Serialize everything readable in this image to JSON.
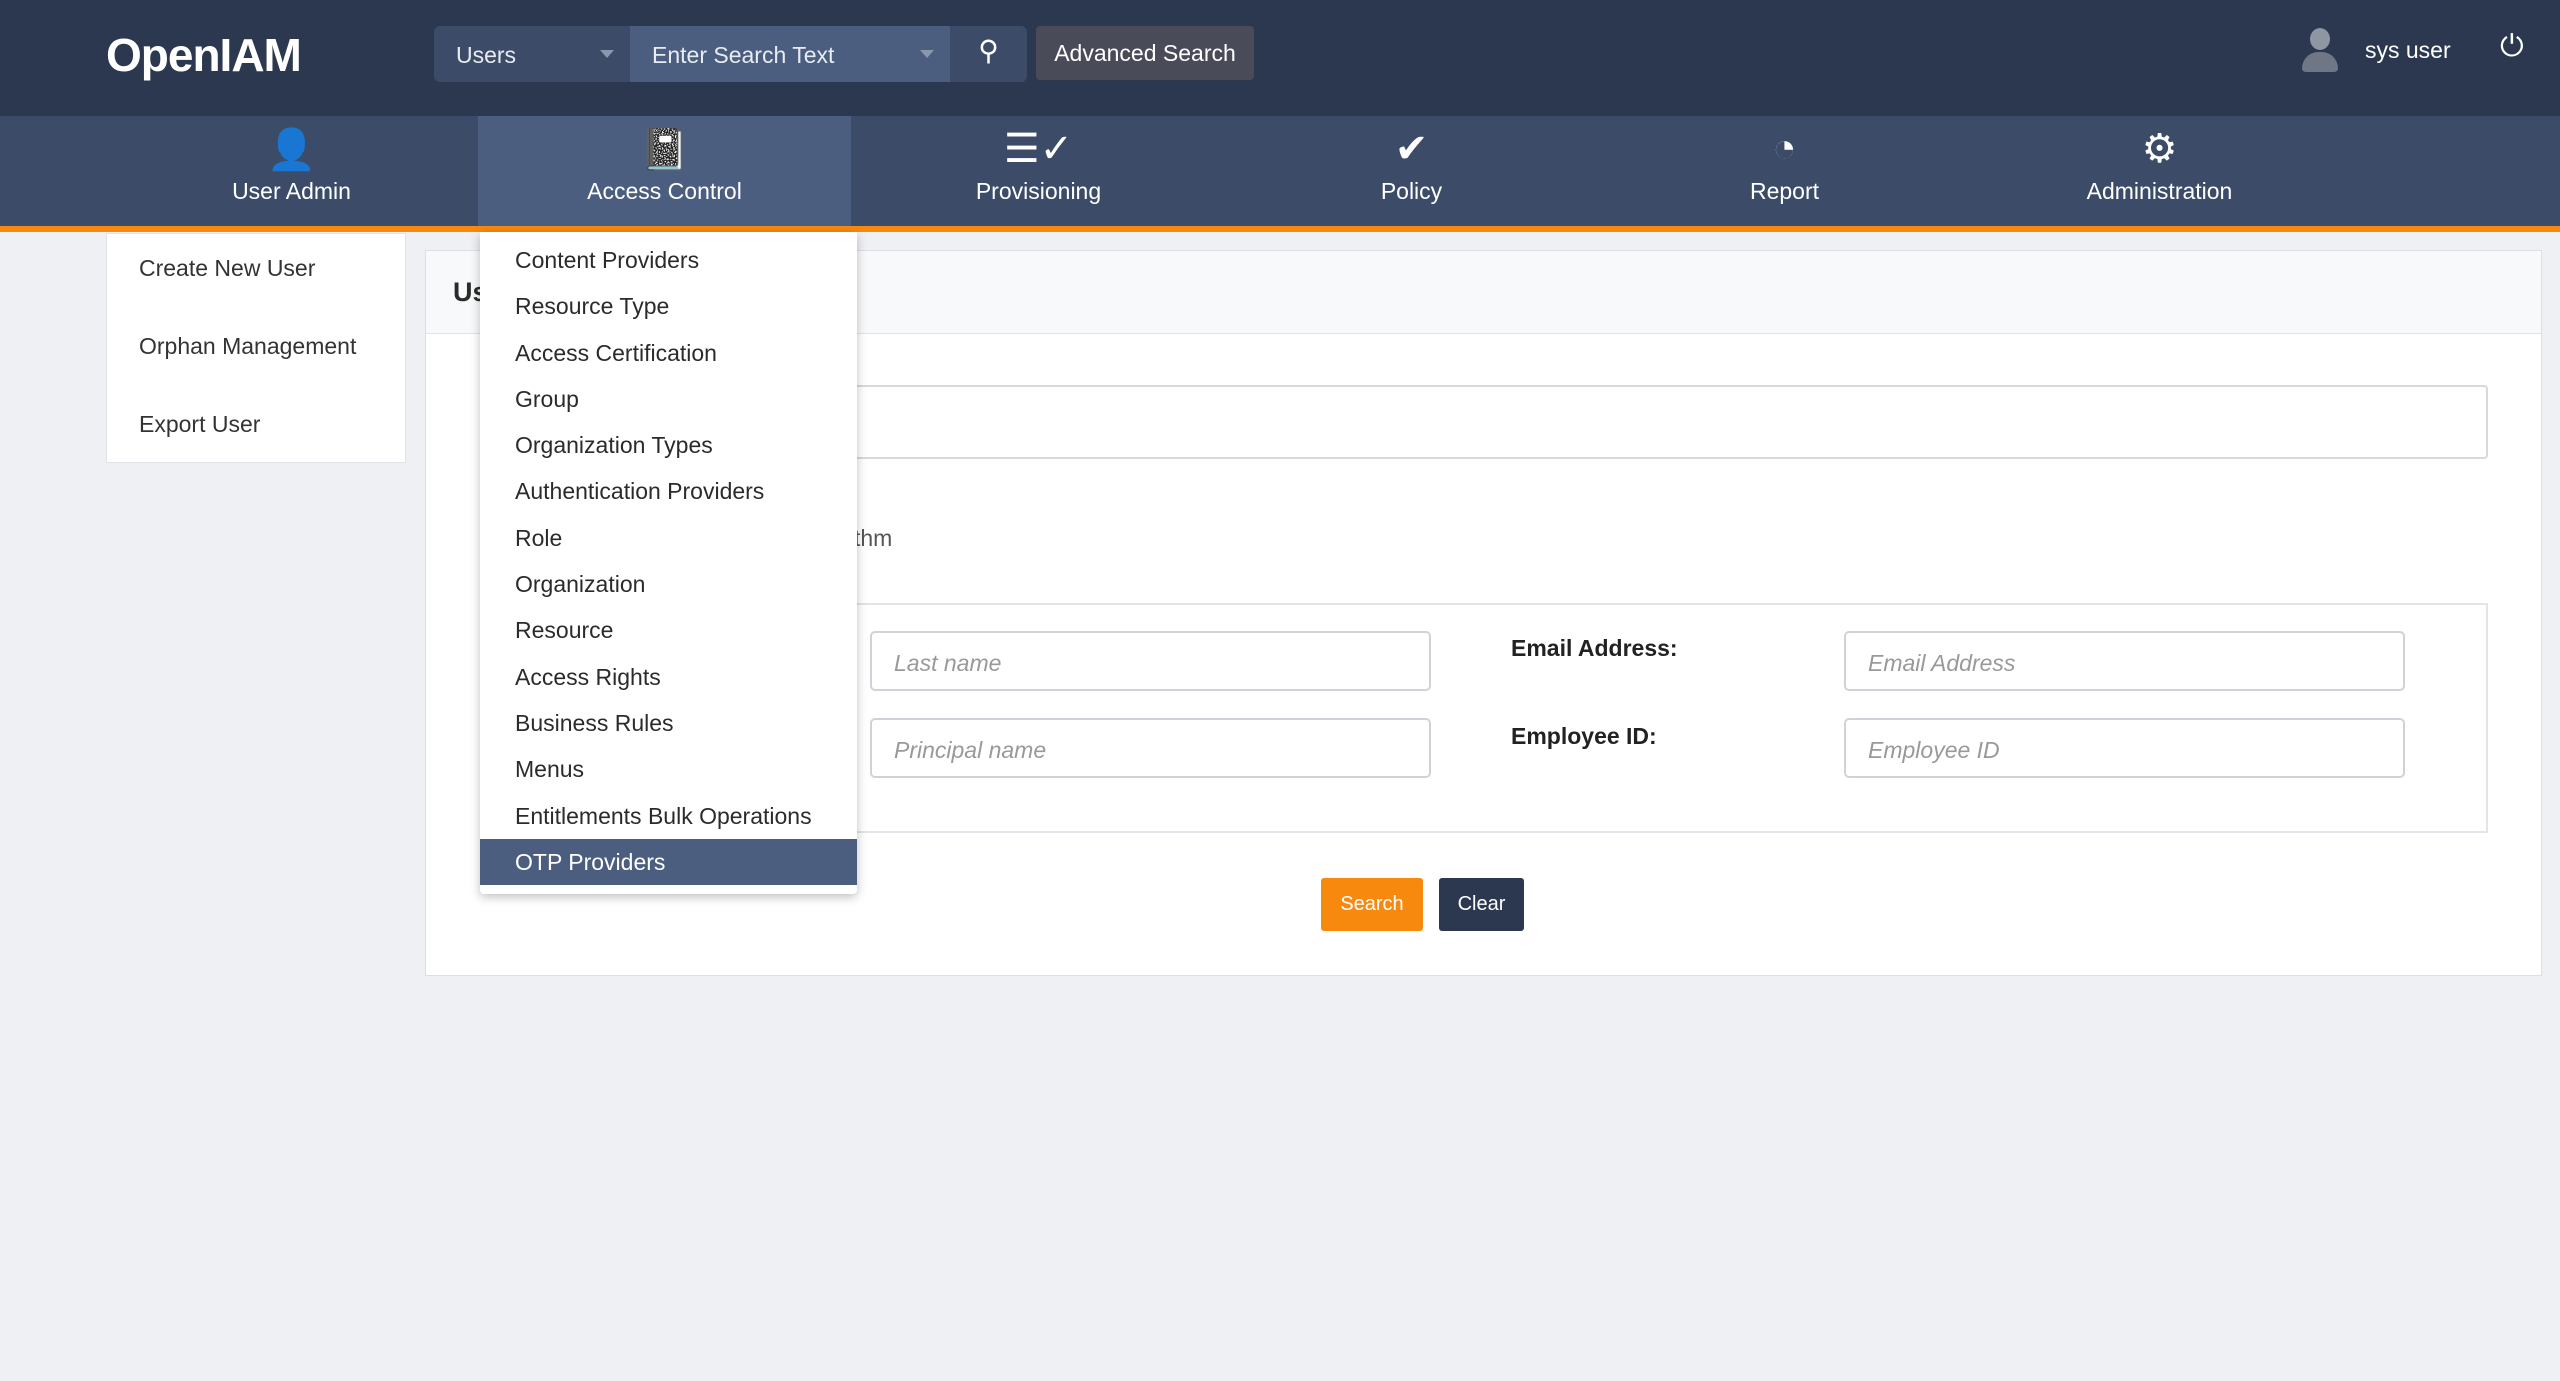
{
  "header": {
    "logo": "OpenIAM",
    "search_category": "Users",
    "search_placeholder": "Enter Search Text",
    "advanced_search": "Advanced Search",
    "user_name": "sys user"
  },
  "nav": [
    {
      "label": "User Admin",
      "icon": "user-icon"
    },
    {
      "label": "Access Control",
      "icon": "notebook-icon"
    },
    {
      "label": "Provisioning",
      "icon": "provisioning-icon"
    },
    {
      "label": "Policy",
      "icon": "check-circle-icon"
    },
    {
      "label": "Report",
      "icon": "pie-chart-icon"
    },
    {
      "label": "Administration",
      "icon": "gear-icon"
    }
  ],
  "sidebar": [
    "Create New User",
    "Orphan Management",
    "Export User"
  ],
  "panel": {
    "title": "Us",
    "partial_text": "thm",
    "last_name_placeholder": "Last name",
    "principal_placeholder": "Principal name",
    "email_label": "Email Address:",
    "email_placeholder": "Email Address",
    "employee_label": "Employee ID:",
    "employee_placeholder": "Employee ID",
    "search": "Search",
    "clear": "Clear"
  },
  "dropdown": {
    "selected": "OTP Providers",
    "items": [
      "Content Providers",
      "Resource Type",
      "Access Certification",
      "Group",
      "Organization Types",
      "Authentication Providers",
      "Role",
      "Organization",
      "Resource",
      "Access Rights",
      "Business Rules",
      "Menus",
      "Entitlements Bulk Operations",
      "OTP Providers"
    ]
  },
  "colors": {
    "topbar": "#2c3850",
    "nav": "#3c4c68",
    "active": "#4b5e80",
    "accent": "#f7890f"
  }
}
